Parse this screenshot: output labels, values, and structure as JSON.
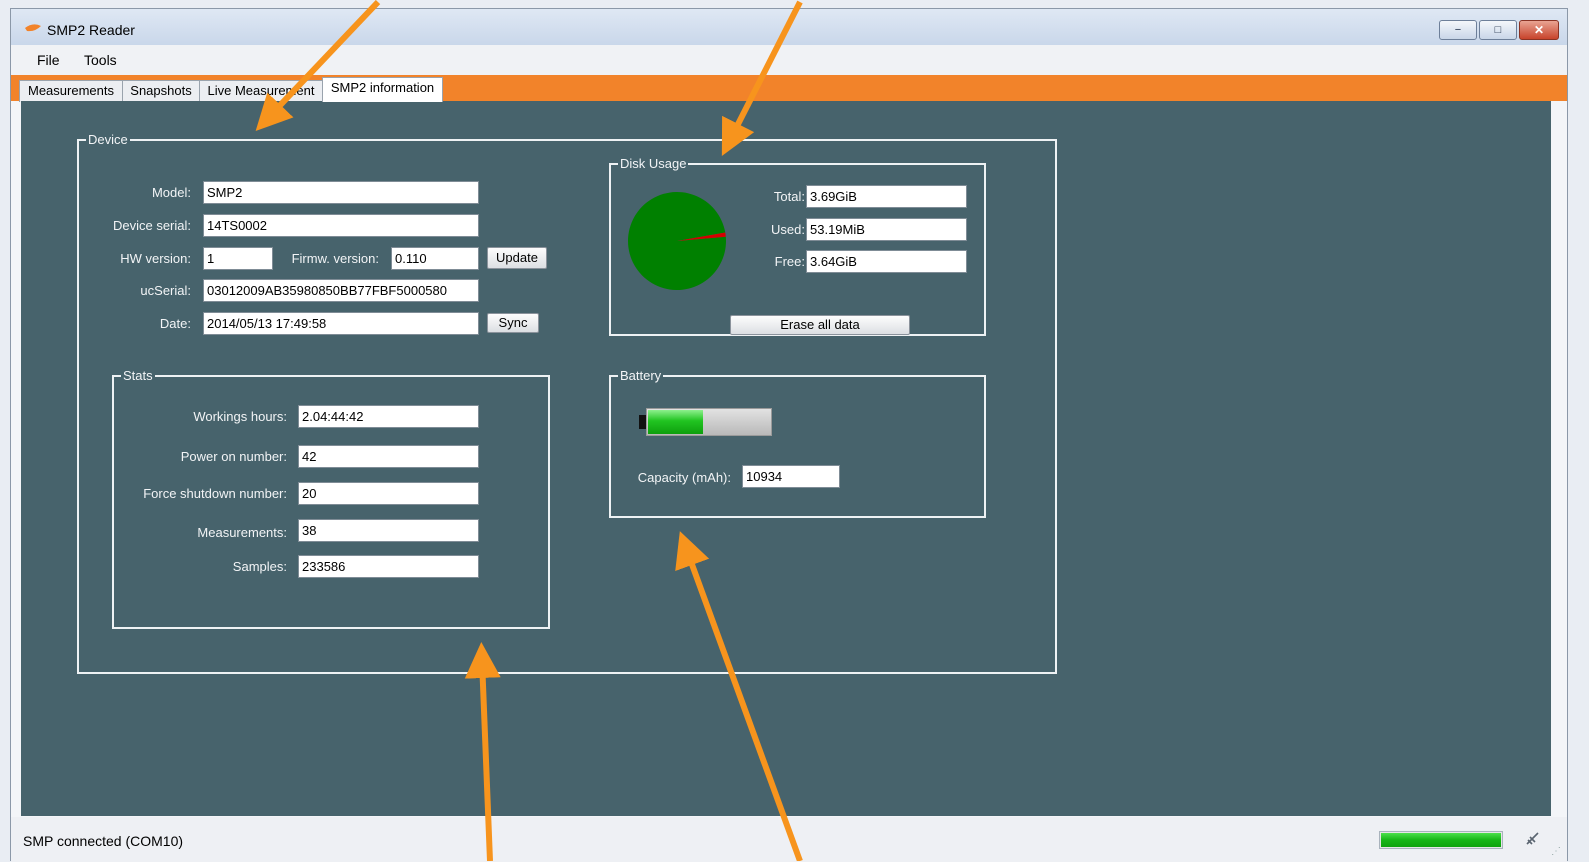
{
  "window": {
    "title": "SMP2 Reader",
    "controls": {
      "minimize": "−",
      "maximize": "□",
      "close": "✕"
    }
  },
  "menu": [
    {
      "label": "File"
    },
    {
      "label": "Tools"
    }
  ],
  "tabs": [
    {
      "label": "Measurements",
      "active": false
    },
    {
      "label": "Snapshots",
      "active": false
    },
    {
      "label": "Live Measurement",
      "active": false
    },
    {
      "label": "SMP2 information",
      "active": true
    }
  ],
  "device": {
    "legend": "Device",
    "model_label": "Model:",
    "model": "SMP2",
    "serial_label": "Device serial:",
    "serial": "14TS0002",
    "hw_label": "HW version:",
    "hw_version": "1",
    "fw_label": "Firmw. version:",
    "fw_version": "0.110",
    "update_button": "Update",
    "ucserial_label": "ucSerial:",
    "ucserial": "03012009AB35980850BB77FBF5000580",
    "date_label": "Date:",
    "date": "2014/05/13 17:49:58",
    "sync_button": "Sync"
  },
  "stats": {
    "legend": "Stats",
    "working_hours_label": "Workings hours:",
    "working_hours": "2.04:44:42",
    "power_on_label": "Power on number:",
    "power_on": "42",
    "force_shutdown_label": "Force shutdown number:",
    "force_shutdown": "20",
    "measurements_label": "Measurements:",
    "measurements": "38",
    "samples_label": "Samples:",
    "samples": "233586"
  },
  "disk": {
    "legend": "Disk Usage",
    "total_label": "Total:",
    "total": "3.69GiB",
    "used_label": "Used:",
    "used": "53.19MiB",
    "free_label": "Free:",
    "free": "3.64GiB",
    "erase_button": "Erase all data",
    "used_fraction": 0.014,
    "free_color": "#008000",
    "used_color": "#d40000"
  },
  "battery": {
    "legend": "Battery",
    "level_fraction": 0.45,
    "capacity_label": "Capacity (mAh):",
    "capacity": "10934"
  },
  "status": {
    "text": "SMP connected (COM10)",
    "progress_fraction": 1.0
  },
  "colors": {
    "tab_accent": "#f2832a",
    "panel_background": "#47636c",
    "annotation_arrow": "#f7941d"
  }
}
